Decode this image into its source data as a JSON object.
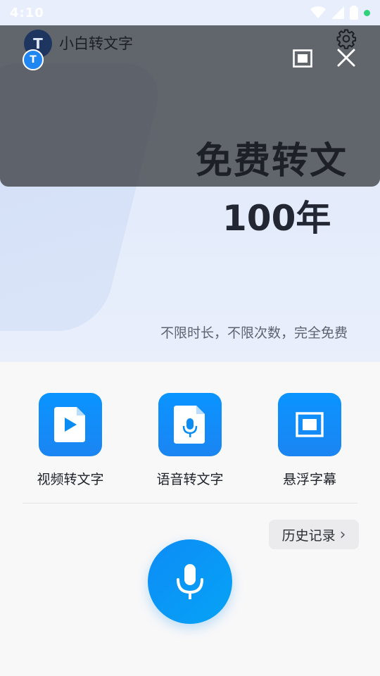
{
  "status_bar": {
    "time": "4:10",
    "icons": [
      "wifi-icon",
      "signal-icon",
      "battery-icon",
      "notification-dot-icon"
    ]
  },
  "app": {
    "name": "小白转文字",
    "logo_letter": "T"
  },
  "overlay": {
    "icons": [
      "settings-gear-icon",
      "picture-in-picture-icon",
      "close-icon"
    ]
  },
  "hero": {
    "line1": "免费转文",
    "line2": "100年",
    "subtitle": "不限时长，不限次数，完全免费"
  },
  "features": [
    {
      "label": "视频转文字",
      "icon": "video-file-icon"
    },
    {
      "label": "语音转文字",
      "icon": "audio-file-icon"
    },
    {
      "label": "悬浮字幕",
      "icon": "floating-window-icon"
    }
  ],
  "history": {
    "label": "历史记录",
    "chevron": "›"
  },
  "record": {
    "icon": "microphone-icon"
  },
  "colors": {
    "accent": "#0a94ff",
    "overlay": "#4a4e54",
    "hero_bg": "#e6edfb"
  }
}
